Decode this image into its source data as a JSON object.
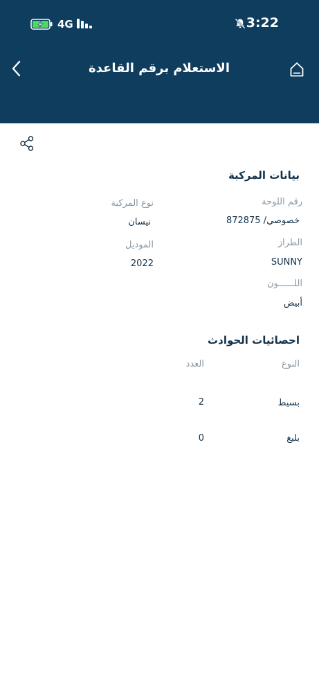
{
  "status_bar": {
    "time": "3:22",
    "network": "4G"
  },
  "header": {
    "title": "الاستعلام برقم القاعدة"
  },
  "vehicle_data": {
    "title": "بيانات المركبة",
    "plate_label": "رقم اللوحة",
    "plate_value": "خصوصي/ 872875",
    "type_label": "نوع المركبة",
    "type_value": "نيسان",
    "model_label": "الطراز",
    "model_value": "SUNNY",
    "year_label": "الموديل",
    "year_value": "2022",
    "color_label": "اللــــــون",
    "color_value": "أبيض"
  },
  "accident_stats": {
    "title": "احصائيات الحوادث",
    "headers": {
      "type": "النوع",
      "count": "العدد"
    },
    "rows": [
      {
        "type": "بسيط",
        "count": "2"
      },
      {
        "type": "بليغ",
        "count": "0"
      }
    ]
  },
  "colors": {
    "header_bg": "#0f3d5e",
    "text_primary": "#13324a",
    "text_label": "#8a98a6",
    "battery_green": "#4cd964"
  }
}
